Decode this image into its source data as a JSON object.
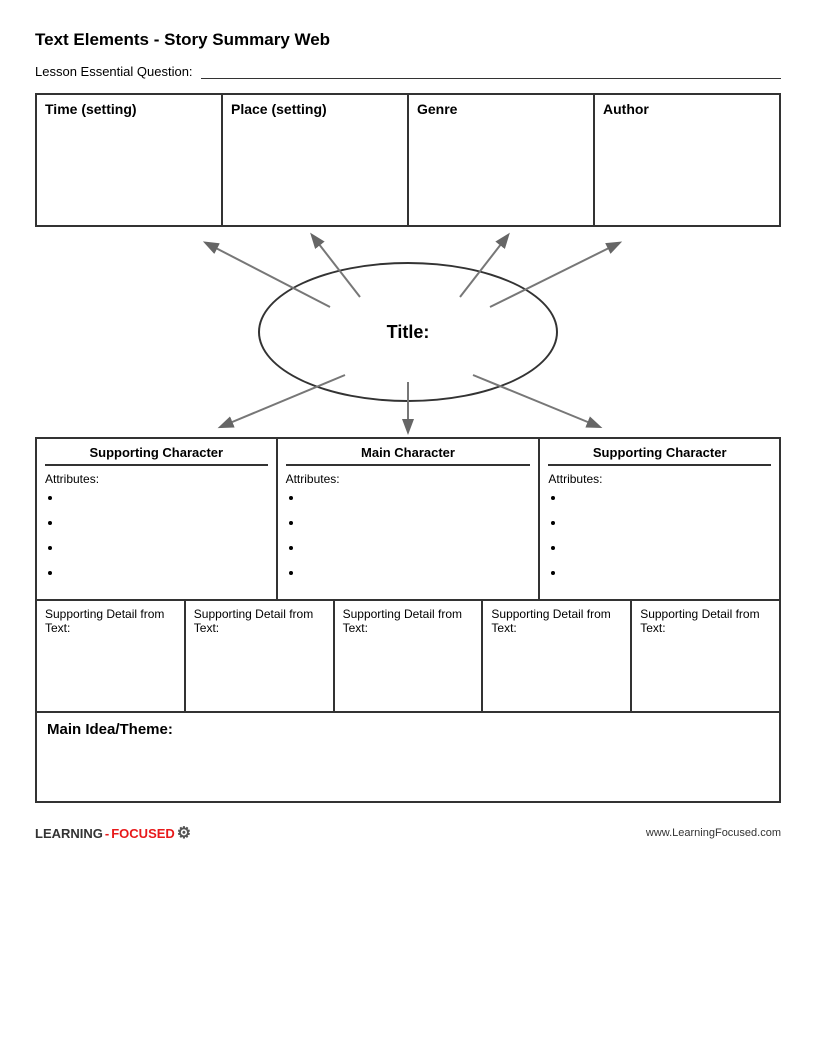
{
  "title": "Text Elements - Story Summary Web",
  "lesson_question_label": "Lesson Essential Question:",
  "top_boxes": [
    {
      "label": "Time (setting)"
    },
    {
      "label": "Place (setting)"
    },
    {
      "label": "Genre"
    },
    {
      "label": "Author"
    }
  ],
  "ellipse_label": "Title:",
  "char_boxes": [
    {
      "label": "Supporting Character",
      "attrs_label": "Attributes:",
      "bullets": [
        "",
        "",
        "",
        ""
      ]
    },
    {
      "label": "Main Character",
      "attrs_label": "Attributes:",
      "bullets": [
        "",
        "",
        "",
        ""
      ]
    },
    {
      "label": "Supporting Character",
      "attrs_label": "Attributes:",
      "bullets": [
        "",
        "",
        "",
        ""
      ]
    }
  ],
  "detail_boxes": [
    {
      "label": "Supporting Detail from Text:"
    },
    {
      "label": "Supporting Detail from Text:"
    },
    {
      "label": "Supporting Detail from Text:"
    },
    {
      "label": "Supporting Detail from Text:"
    },
    {
      "label": "Supporting Detail from Text:"
    }
  ],
  "main_idea_label": "Main Idea/Theme:",
  "footer": {
    "logo_learning": "LEARNING",
    "logo_dash": "-",
    "logo_focused": "FOCUSED",
    "url": "www.LearningFocused.com"
  }
}
